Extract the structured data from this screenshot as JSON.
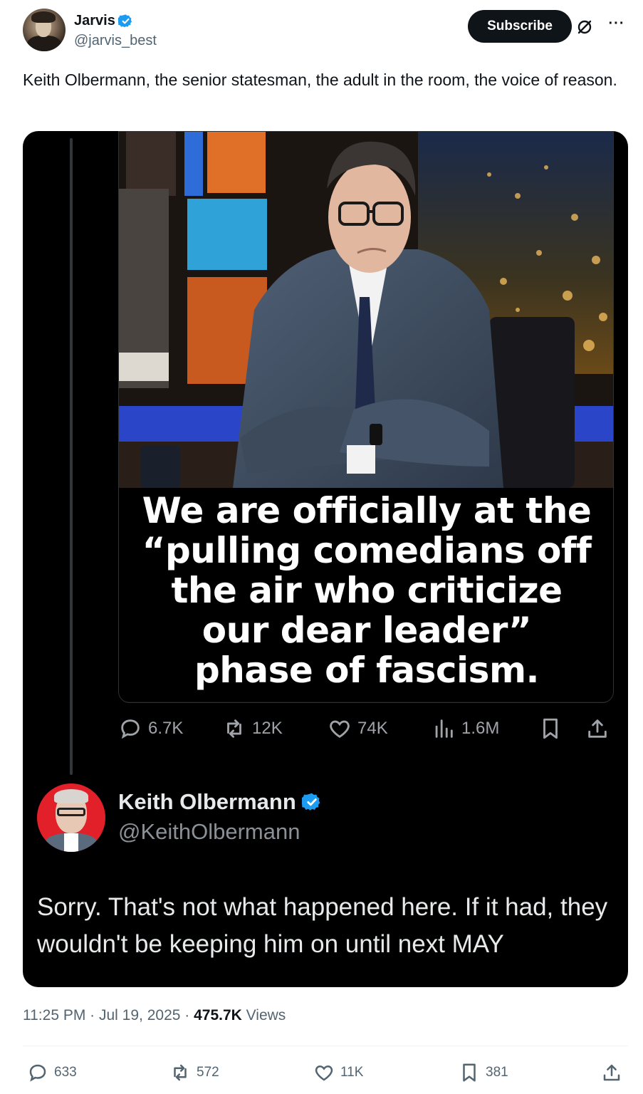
{
  "author": {
    "display_name": "Jarvis",
    "handle": "@jarvis_best"
  },
  "header": {
    "subscribe_label": "Subscribe",
    "more_label": "···"
  },
  "tweet": {
    "text": "Keith Olbermann, the senior statesman, the adult in the room, the voice of reason."
  },
  "quoted_image": {
    "caption_lines": [
      "We are officially at the",
      "“pulling comedians off",
      "the air who criticize",
      "our dear leader”",
      "phase of fascism."
    ],
    "stats": {
      "replies": "6.7K",
      "reposts": "12K",
      "likes": "74K",
      "views": "1.6M"
    }
  },
  "reply": {
    "display_name": "Keith Olbermann",
    "handle": "@KeithOlbermann",
    "text": "Sorry. That's not what happened here. If it had, they wouldn't be keeping him on until next MAY"
  },
  "meta": {
    "time": "11:25 PM",
    "date": "Jul 19, 2025",
    "views_count": "475.7K",
    "views_label": "Views"
  },
  "actions": {
    "replies": "633",
    "reposts": "572",
    "likes": "11K",
    "bookmarks": "381"
  },
  "colors": {
    "verified_blue": "#1d9bf0",
    "card_background": "#000000",
    "muted_text": "#536471"
  }
}
